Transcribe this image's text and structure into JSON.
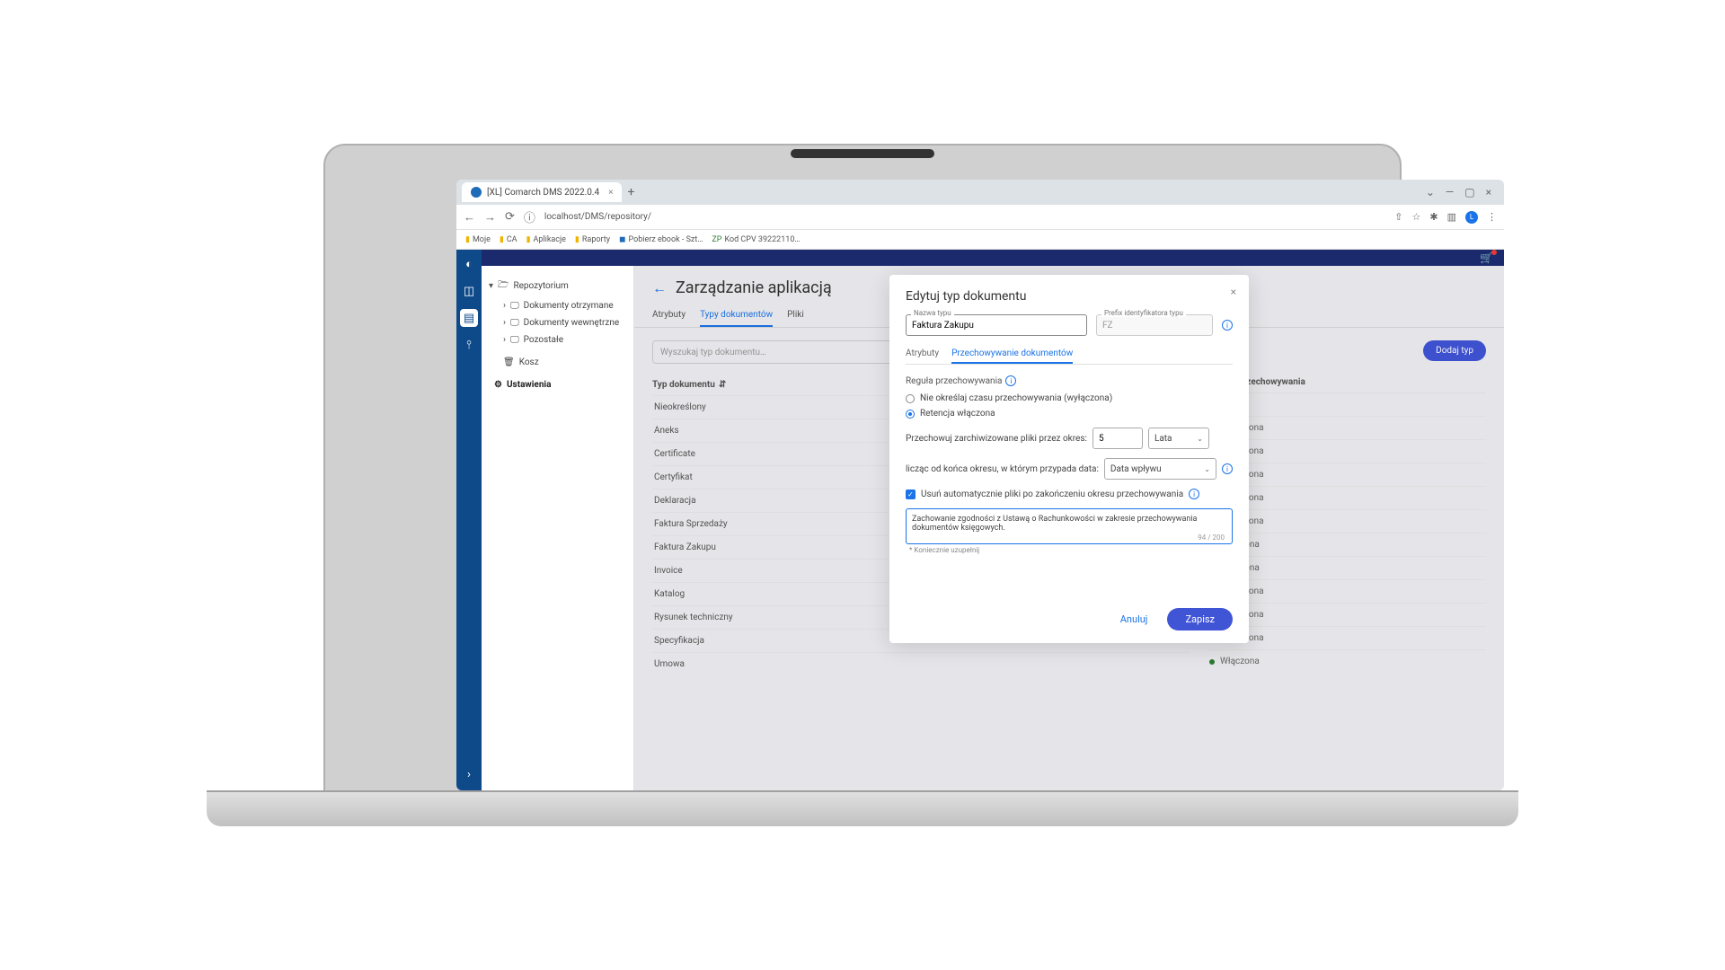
{
  "browser": {
    "tab_title": "[XL] Comarch DMS 2022.0.4",
    "url": "localhost/DMS/repository/",
    "bookmarks": [
      "Moje",
      "CA",
      "Aplikacje",
      "Raporty",
      "Pobierz ebook - Szt…",
      "Kod CPV 39222110…"
    ]
  },
  "sidebar_tree": {
    "root": "Repozytorium",
    "children": [
      "Dokumenty otrzymane",
      "Dokumenty wewnętrzne",
      "Pozostałe"
    ],
    "trash": "Kosz",
    "settings": "Ustawienia"
  },
  "page": {
    "title": "Zarządzanie aplikacją",
    "tabs": [
      "Atrybuty",
      "Typy dokumentów",
      "Pliki"
    ],
    "active_tab": 1
  },
  "list": {
    "search_placeholder": "Wyszukaj typ dokumentu…",
    "col_type": "Typ dokumentu",
    "col_rule": "Reguła przechowywania",
    "add_button": "Dodaj typ",
    "rows": [
      "Nieokreślony",
      "Aneks",
      "Certificate",
      "Certyfikat",
      "Deklaracja",
      "Faktura Sprzedaży",
      "Faktura Zakupu",
      "Invoice",
      "Katalog",
      "Rysunek techniczny",
      "Specyfikacja",
      "Umowa"
    ],
    "rules": [
      {
        "text": "–",
        "status": "none"
      },
      {
        "text": "Wyłączona",
        "status": "off"
      },
      {
        "text": "Wyłączona",
        "status": "off"
      },
      {
        "text": "Wyłączona",
        "status": "off"
      },
      {
        "text": "Wyłączona",
        "status": "off"
      },
      {
        "text": "Wyłączona",
        "status": "off"
      },
      {
        "text": "Włączona",
        "status": "on"
      },
      {
        "text": "Włączona",
        "status": "on"
      },
      {
        "text": "Wyłączona",
        "status": "off"
      },
      {
        "text": "Wyłączona",
        "status": "off"
      },
      {
        "text": "Wyłączona",
        "status": "off"
      },
      {
        "text": "Włączona",
        "status": "on"
      }
    ]
  },
  "modal": {
    "title": "Edytuj typ dokumentu",
    "name_label": "Nazwa typu",
    "name_value": "Faktura Zakupu",
    "prefix_label": "Prefix identyfikatora typu",
    "prefix_value": "FZ",
    "tabs": [
      "Atrybuty",
      "Przechowywanie dokumentów"
    ],
    "active_tab": 1,
    "rule_section": "Reguła przechowywania",
    "radio_off": "Nie określaj czasu przechowywania (wyłączona)",
    "radio_on": "Retencja włączona",
    "store_label": "Przechowuj zarchiwizowane pliki przez okres:",
    "store_value": "5",
    "store_unit": "Lata",
    "count_label": "licząc od końca okresu, w którym przypada data:",
    "count_value": "Data wpływu",
    "auto_delete": "Usuń automatycznie pliki po zakończeniu okresu przechowywania",
    "desc_value": "Zachowanie zgodności z Ustawą o Rachunkowości w zakresie przechowywania dokumentów księgowych.",
    "char_count": "94 / 200",
    "required_note": "* Koniecznie uzupełnij",
    "cancel": "Anuluj",
    "save": "Zapisz"
  }
}
